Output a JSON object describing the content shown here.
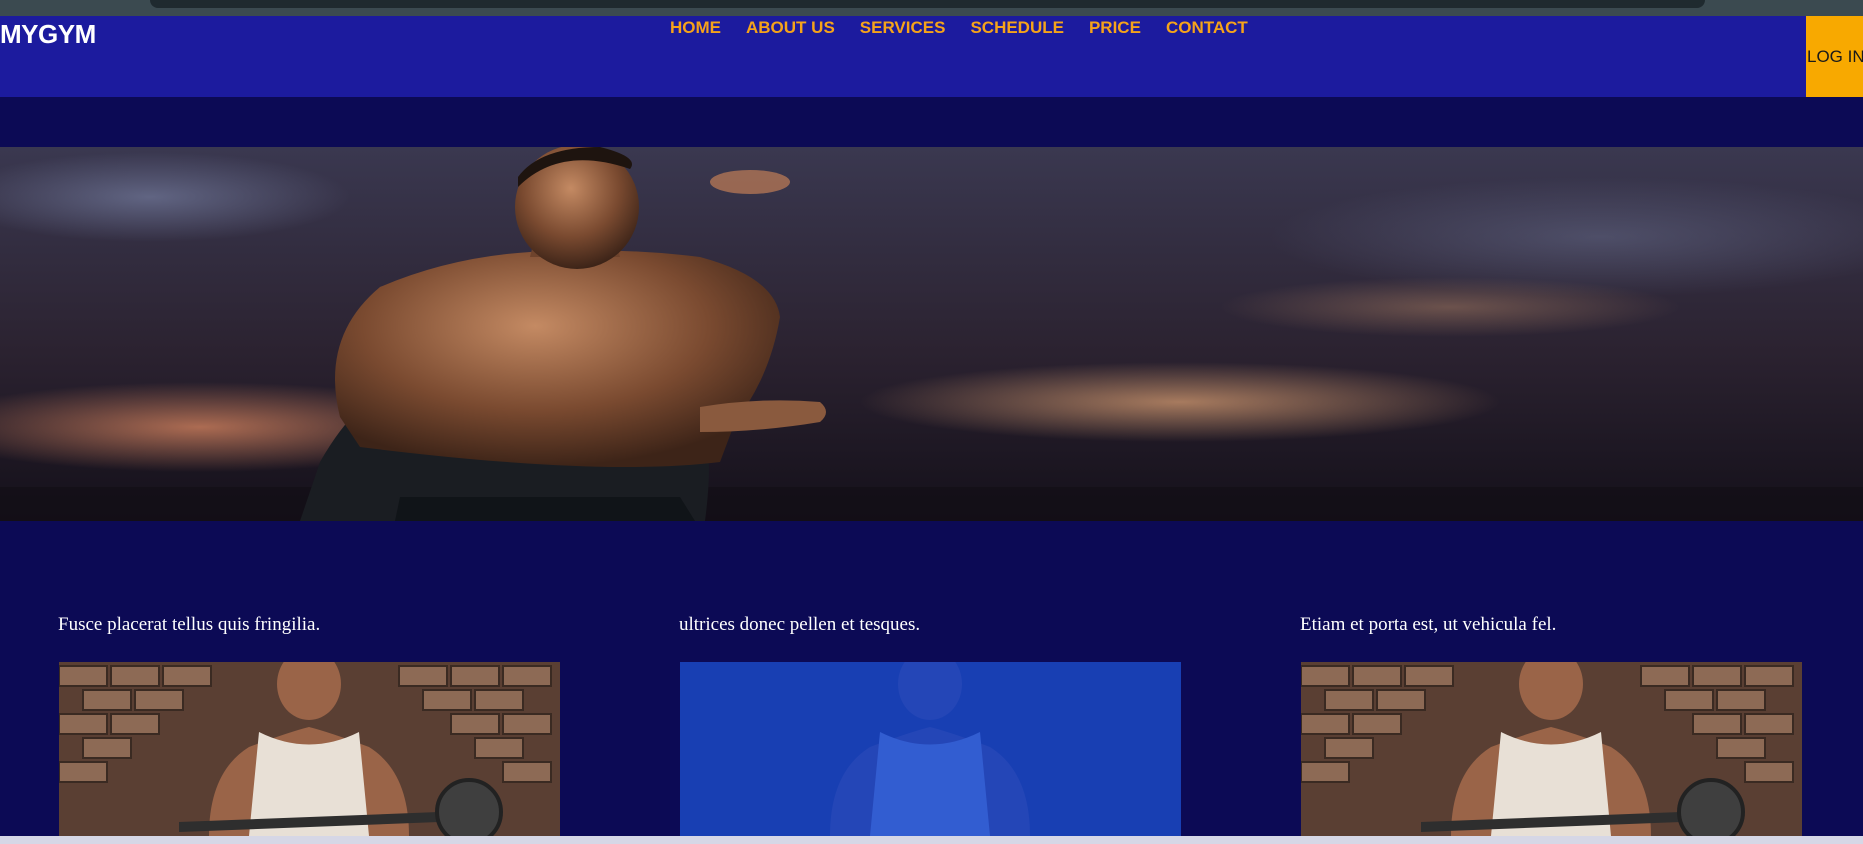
{
  "header": {
    "logo": "MYGYM",
    "nav": [
      "HOME",
      "ABOUT US",
      "SERVICES",
      "SCHEDULE",
      "PRICE",
      "CONTACT"
    ],
    "login_label": "LOG IN"
  },
  "cards": [
    {
      "title": "Fusce placerat tellus quis fringilia.",
      "highlighted": false
    },
    {
      "title": "ultrices donec pellen et tesques.",
      "highlighted": true
    },
    {
      "title": "Etiam et porta est, ut vehicula fel.",
      "highlighted": false
    }
  ],
  "colors": {
    "page_bg": "#0c0a55",
    "header_bg": "#1c1b9e",
    "nav_text": "#f5a31a",
    "login_bg": "#f8a900",
    "card_overlay": "#0a3fd0"
  }
}
